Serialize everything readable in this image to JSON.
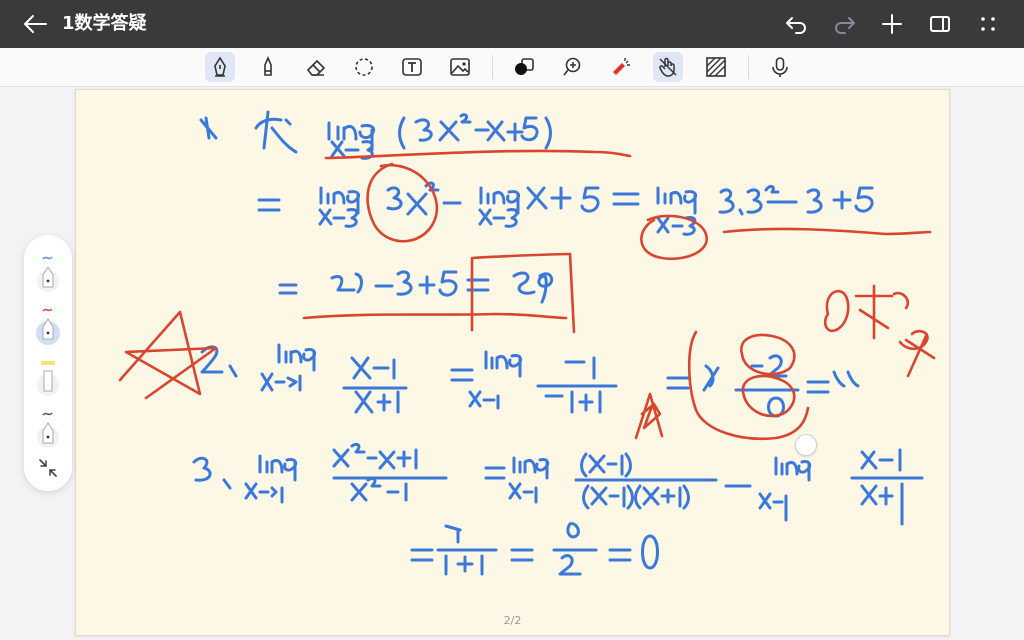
{
  "header": {
    "title": "1数学答疑"
  },
  "page": {
    "indicator": "2/2"
  },
  "toolbar": {
    "tools": [
      "pen-tool",
      "highlighter-tool",
      "eraser-tool",
      "lasso-tool",
      "text-tool",
      "image-tool",
      "color-shape-tool",
      "zoom-tool",
      "laser-pointer-tool",
      "touch-draw-tool",
      "pattern-tool",
      "microphone-tool"
    ],
    "active_tool": "pen-tool"
  },
  "pen_panel": {
    "pens": [
      {
        "name": "blue-pen",
        "color": "#5b8fd8"
      },
      {
        "name": "red-pen",
        "color": "#d04a38"
      },
      {
        "name": "yellow-highlighter",
        "color": "#f5e27a"
      },
      {
        "name": "dark-pen",
        "color": "#555555"
      }
    ],
    "selected": "red-pen"
  },
  "colors": {
    "ink_blue": "#3b78d9",
    "ink_red": "#d9452e",
    "paper": "#fdf8e6",
    "topbar": "#3a3a3d"
  }
}
